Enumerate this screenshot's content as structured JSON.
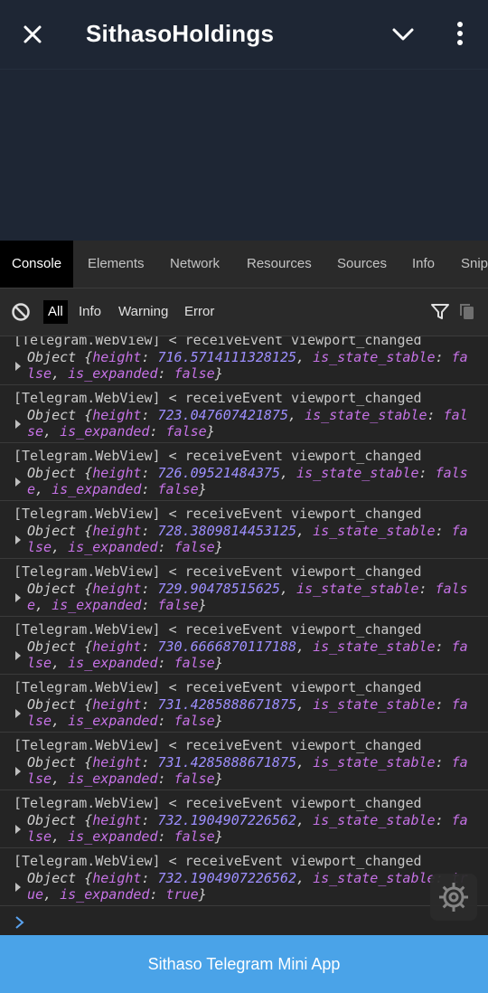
{
  "header": {
    "title": "SithasoHoldings",
    "close_icon": "close-icon",
    "chevron_icon": "chevron-down-icon",
    "more_icon": "more-vertical-icon"
  },
  "devtools": {
    "tabs": [
      "Console",
      "Elements",
      "Network",
      "Resources",
      "Sources",
      "Info",
      "Snip"
    ],
    "levels": [
      "All",
      "Info",
      "Warning",
      "Error"
    ],
    "entries": [
      {
        "head": "[Telegram.WebView] < receiveEvent viewport_changed",
        "height": "716.5714111328125",
        "stable": "false",
        "expanded": "false"
      },
      {
        "head": "[Telegram.WebView] < receiveEvent viewport_changed",
        "height": "723.047607421875",
        "stable": "false",
        "expanded": "false"
      },
      {
        "head": "[Telegram.WebView] < receiveEvent viewport_changed",
        "height": "726.09521484375",
        "stable": "false",
        "expanded": "false"
      },
      {
        "head": "[Telegram.WebView] < receiveEvent viewport_changed",
        "height": "728.3809814453125",
        "stable": "false",
        "expanded": "false"
      },
      {
        "head": "[Telegram.WebView] < receiveEvent viewport_changed",
        "height": "729.90478515625",
        "stable": "false",
        "expanded": "false"
      },
      {
        "head": "[Telegram.WebView] < receiveEvent viewport_changed",
        "height": "730.6666870117188",
        "stable": "false",
        "expanded": "false"
      },
      {
        "head": "[Telegram.WebView] < receiveEvent viewport_changed",
        "height": "731.4285888671875",
        "stable": "false",
        "expanded": "false"
      },
      {
        "head": "[Telegram.WebView] < receiveEvent viewport_changed",
        "height": "731.4285888671875",
        "stable": "false",
        "expanded": "false"
      },
      {
        "head": "[Telegram.WebView] < receiveEvent viewport_changed",
        "height": "732.1904907226562",
        "stable": "false",
        "expanded": "false"
      },
      {
        "head": "[Telegram.WebView] < receiveEvent viewport_changed",
        "height": "732.1904907226562",
        "stable": "true",
        "expanded": "true"
      }
    ]
  },
  "bottom_button": {
    "label": "Sithaso Telegram Mini App"
  },
  "colors": {
    "header_bg": "#1e2634",
    "button_bg": "#4aa3e8",
    "key": "#c672e6",
    "number": "#9d8fff"
  }
}
